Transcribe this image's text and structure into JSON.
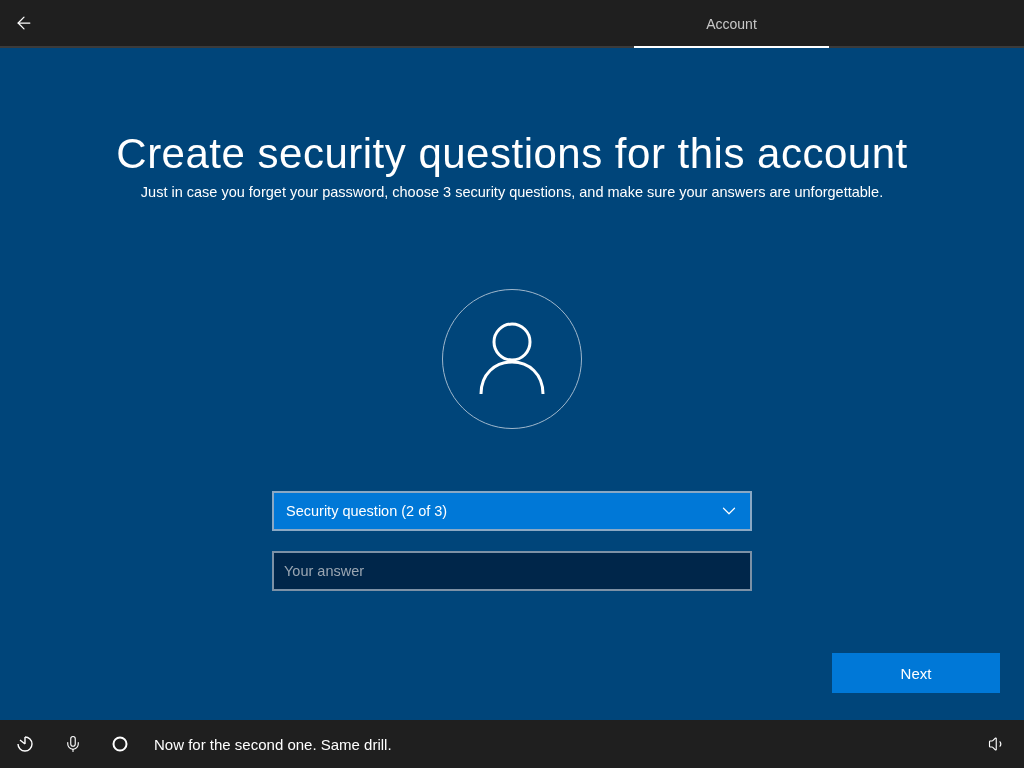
{
  "header": {
    "tabs": [
      {
        "label": "Account",
        "selected": true
      }
    ]
  },
  "title": "Create security questions for this account",
  "subtitle": "Just in case you forget your password, choose 3 security questions, and make sure your answers are unforgettable.",
  "question_dropdown": {
    "value": "Security question (2 of 3)"
  },
  "answer_field": {
    "placeholder": "Your answer"
  },
  "next_button": "Next",
  "status_bar": {
    "message": "Now for the second one. Same drill."
  }
}
